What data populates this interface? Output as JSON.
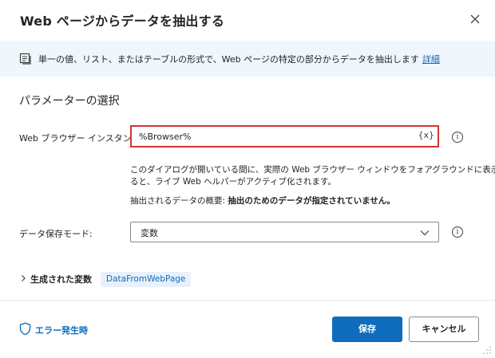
{
  "dialog": {
    "title": "Web ページからデータを抽出する"
  },
  "info_bar": {
    "text": "単一の値、リスト、またはテーブルの形式で、Web ページの特定の部分からデータを抽出します",
    "link": "詳細"
  },
  "section": {
    "title": "パラメーターの選択"
  },
  "browser_field": {
    "label": "Web ブラウザー インスタンス:",
    "value": "%Browser%",
    "variable_button": "{x}",
    "hint_line1": "このダイアログが開いている間に、実際の Web ブラウザー ウィンドウをフォアグラウンドに表示す",
    "hint_line2": "ると、ライブ Web ヘルパーがアクティブ化されます。",
    "summary_label": "抽出されるデータの概要:",
    "summary_value": "抽出のためのデータが指定されていません。"
  },
  "storage_field": {
    "label": "データ保存モード:",
    "value": "変数"
  },
  "variables": {
    "label": "生成された変数",
    "chip": "DataFromWebPage"
  },
  "footer": {
    "error_link": "エラー発生時",
    "save_button": "保存",
    "cancel_button": "キャンセル"
  },
  "colors": {
    "accent": "#0f6cbd",
    "error_border": "#d13438",
    "info_bar_bg": "#eff6fc",
    "chip_bg": "#e8f1fb"
  },
  "icons": {
    "close": "close-icon",
    "info_bar": "info-panel-icon",
    "info": "info-icon",
    "dropdown": "chevron-down-icon",
    "expand": "chevron-right-icon",
    "error": "shield-icon",
    "resize": "resize-grip-icon"
  }
}
